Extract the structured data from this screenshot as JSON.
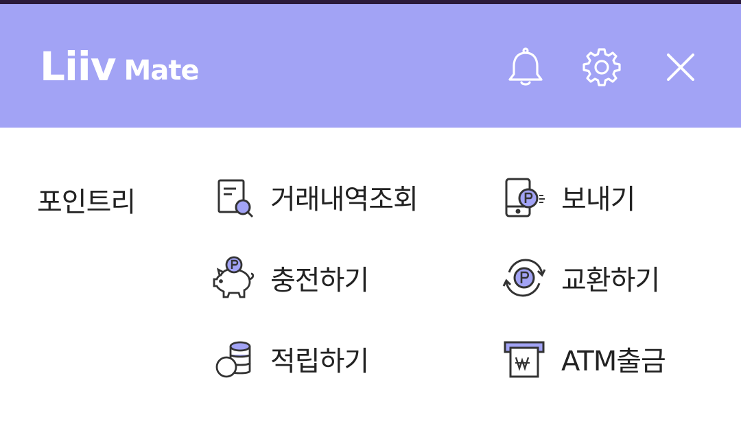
{
  "header": {
    "logo_primary": "Liiv",
    "logo_secondary": "Mate",
    "bell_icon": "bell-icon",
    "settings_icon": "gear-icon",
    "close_icon": "close-icon",
    "background_color": "#a2a3f5"
  },
  "menu": {
    "section_title": "포인트리",
    "items": [
      {
        "label": "거래내역조회",
        "icon": "document-search-icon"
      },
      {
        "label": "보내기",
        "icon": "phone-send-point-icon"
      },
      {
        "label": "충전하기",
        "icon": "piggy-bank-icon"
      },
      {
        "label": "교환하기",
        "icon": "exchange-point-icon"
      },
      {
        "label": "적립하기",
        "icon": "coin-stack-icon"
      },
      {
        "label": "ATM출금",
        "icon": "atm-withdraw-icon"
      }
    ],
    "accent_color": "#a2a3f5"
  }
}
